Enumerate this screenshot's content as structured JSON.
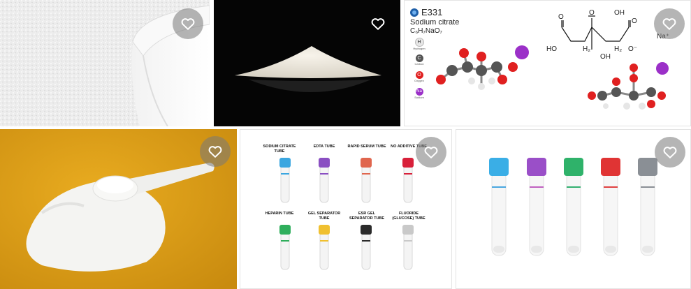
{
  "tiles": [
    {
      "name": "Sodium citrate crystals in a white bowl",
      "favorite": false
    },
    {
      "name": "White powder pile on black background",
      "favorite": false
    },
    {
      "name": "Sodium citrate structure diagram",
      "favorite": false
    },
    {
      "name": "Powder with measuring scoop on orange",
      "favorite": false
    },
    {
      "name": "Blood collection tube types chart",
      "favorite": false
    },
    {
      "name": "Five colored-cap blood tubes",
      "favorite": false
    }
  ],
  "chem": {
    "code": "E331",
    "name": "Sodium citrate",
    "formula": "C₆H₇NaO₇",
    "legend": [
      {
        "sym": "H",
        "label": "Hydrogen",
        "color": "#e6e6e6"
      },
      {
        "sym": "C",
        "label": "Carbon",
        "color": "#555555"
      },
      {
        "sym": "O",
        "label": "Oxygen",
        "color": "#e02020"
      },
      {
        "sym": "Na",
        "label": "Sodium",
        "color": "#9b30c8"
      }
    ],
    "struct": {
      "o_left": "O",
      "ho_left": "HO",
      "h2_left": "H₂",
      "o_top": "O",
      "oh_top": "OH",
      "oh_mid": "OH",
      "o_right": "O",
      "o_minus": "O⁻",
      "na_plus": "Na⁺",
      "h2_right": "H₂"
    }
  },
  "tube_chart": {
    "labels": [
      "SODIUM CITRATE TUBE",
      "EDTA TUBE",
      "RAPID SERUM TUBE",
      "NO ADDITIVE TUBE",
      "HEPARIN TUBE",
      "GEL SEPARATOR TUBE",
      "ESR GEL SEPARATOR TUBE",
      "FLUORIDE (GLUCOSE) TUBE"
    ],
    "cap_colors": [
      "#3aa6e0",
      "#8a4fc2",
      "#e0664e",
      "#d8203a",
      "#2fae5c",
      "#f0c030",
      "#2b2b2b",
      "#c9c9c9"
    ]
  },
  "tube_photo": {
    "cap_colors": [
      "#3aaee6",
      "#9a4fc8",
      "#2fb26a",
      "#e03434",
      "#8a8f95"
    ],
    "stripe_colors": [
      "#4aa7e0",
      "#c060c0",
      "#33b070",
      "#e04040",
      "#8a8f95"
    ]
  }
}
